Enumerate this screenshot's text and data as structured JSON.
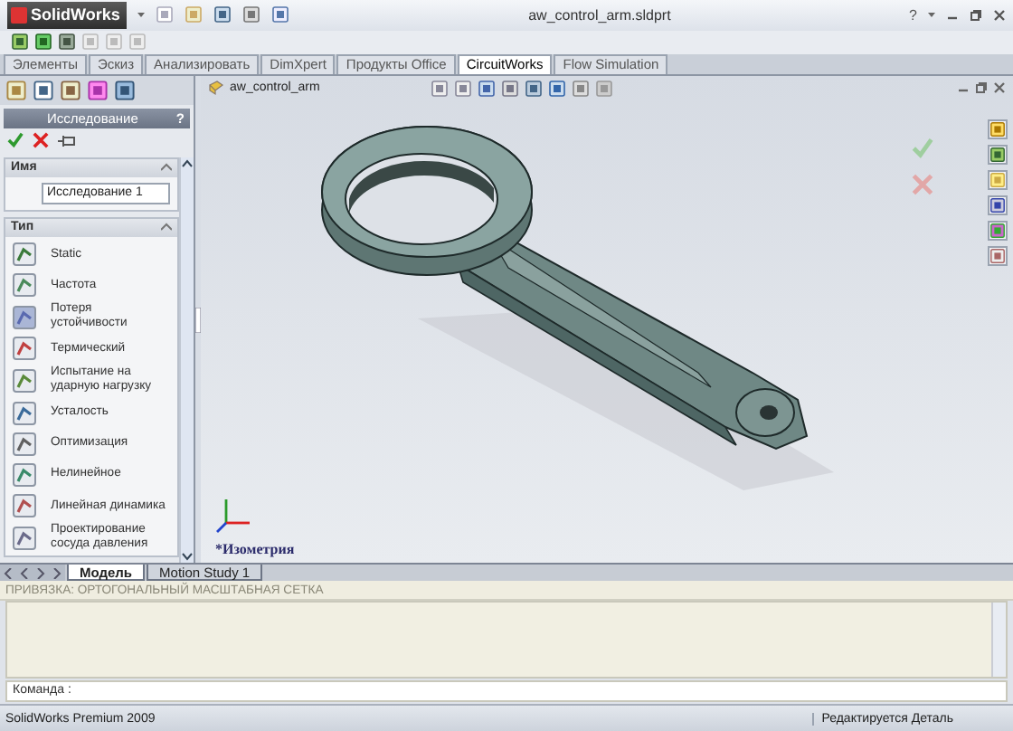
{
  "window": {
    "app": "SolidWorks",
    "title": "aw_control_arm.sldprt",
    "help": "?"
  },
  "command_tabs": [
    {
      "label": "Элементы",
      "selected": false
    },
    {
      "label": "Эскиз",
      "selected": false
    },
    {
      "label": "Анализировать",
      "selected": false
    },
    {
      "label": "DimXpert",
      "selected": false
    },
    {
      "label": "Продукты Office",
      "selected": false
    },
    {
      "label": "CircuitWorks",
      "selected": true
    },
    {
      "label": "Flow Simulation",
      "selected": false
    }
  ],
  "panel": {
    "title": "Исследование",
    "help": "?",
    "name_group": {
      "label": "Имя",
      "value": "Исследование 1"
    },
    "type_group": {
      "label": "Тип",
      "items": [
        {
          "label": "Static",
          "selected": false
        },
        {
          "label": "Частота",
          "selected": false
        },
        {
          "label": "Потеря устойчивости",
          "selected": true
        },
        {
          "label": "Термический",
          "selected": false
        },
        {
          "label": "Испытание на ударную нагрузку",
          "selected": false
        },
        {
          "label": "Усталость",
          "selected": false
        },
        {
          "label": "Оптимизация",
          "selected": false
        },
        {
          "label": "Нелинейное",
          "selected": false
        },
        {
          "label": "Линейная динамика",
          "selected": false
        },
        {
          "label": "Проектирование сосуда давления",
          "selected": false
        }
      ]
    }
  },
  "viewport": {
    "tree_root": "aw_control_arm",
    "view_label": "*Изометрия"
  },
  "bottom_tabs": [
    {
      "label": "Модель",
      "selected": true
    },
    {
      "label": "Motion Study 1",
      "selected": false
    }
  ],
  "command_area": {
    "snap_status": "ПРИВЯЗКА: ОРТОГОНАЛЬНЫЙ  МАСШТАБНАЯ СЕТКА",
    "prompt": "Команда :"
  },
  "status_bar": {
    "product": "SolidWorks Premium 2009",
    "mode": "Редактируется Деталь"
  }
}
